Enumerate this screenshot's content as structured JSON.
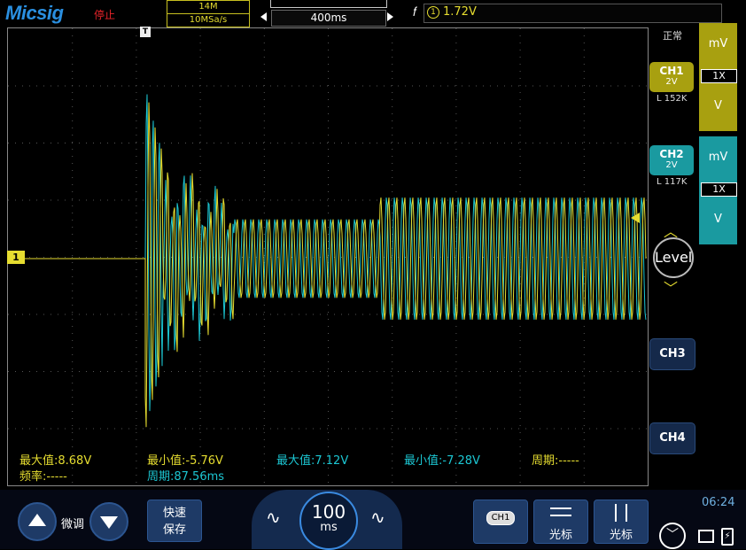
{
  "header": {
    "brand": "Micsig",
    "run_state": "停止",
    "memory_depth": "14M",
    "sample_rate": "10MSa/s",
    "timebase": "400ms",
    "trigger_channel": "1",
    "trigger_level": "1.72V"
  },
  "screen": {
    "trigger_marker": "T",
    "ch1_marker": "1",
    "measurements": [
      {
        "text": "最大值:8.68V"
      },
      {
        "text": "最小值:-5.76V"
      },
      {
        "text": "最大值:7.12V"
      },
      {
        "text": "最小值:-7.28V"
      },
      {
        "text": "周期:-----"
      },
      {
        "text": "频率:-----"
      },
      {
        "text": "周期:87.56ms"
      }
    ]
  },
  "right_panel": {
    "mode": "正常",
    "ch1": {
      "label": "CH1",
      "scale": "2V",
      "limit": "L 152K",
      "unit_top": "mV",
      "probe": "1X",
      "unit_bottom": "V",
      "color": "#e6dd30"
    },
    "ch2": {
      "label": "CH2",
      "scale": "2V",
      "limit": "L 117K",
      "unit_top": "mV",
      "probe": "1X",
      "unit_bottom": "V",
      "color": "#1cc6d2"
    },
    "level_label": "Level",
    "ch3_label": "CH3",
    "ch4_label": "CH4"
  },
  "bottom_bar": {
    "fine_label": "微调",
    "save_line1": "快速",
    "save_line2": "保存",
    "knob_value": "100",
    "knob_unit": "ms",
    "ch_select_label": "CH1",
    "cursor1_label": "光标",
    "cursor2_label": "光标",
    "clock": "06:24"
  },
  "icons": {
    "up": "arrow-up-icon",
    "down": "arrow-down-icon",
    "wave": "sine-wave-icon",
    "collapse": "chevron-down-circle-icon",
    "monitor": "monitor-icon",
    "battery": "battery-icon"
  }
}
